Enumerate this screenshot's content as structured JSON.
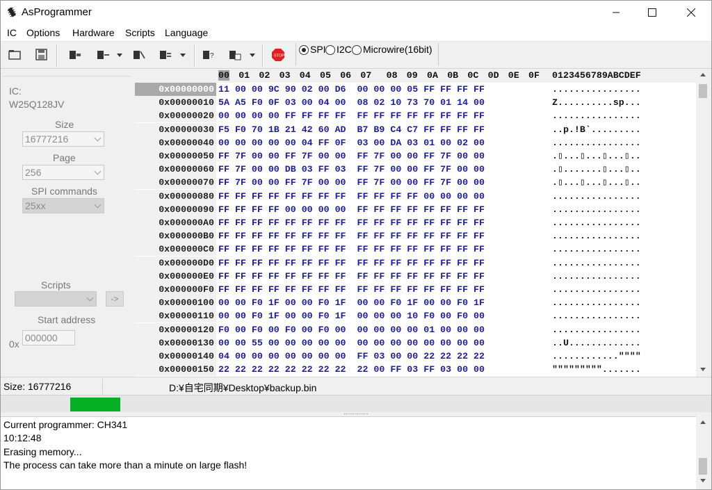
{
  "window": {
    "title": "AsProgrammer"
  },
  "menu": [
    "IC",
    "Options",
    "Hardware",
    "Scripts",
    "Language"
  ],
  "toolbar": {
    "icons": [
      "open-file-icon",
      "save-icon",
      "read-chip-icon",
      "write-chip-icon",
      "erase-chip-icon",
      "verify-chip-icon",
      "read-id-icon",
      "options-icon",
      "stop-icon"
    ],
    "protocols": [
      {
        "label": "SPI",
        "checked": true
      },
      {
        "label": "I2C",
        "checked": false
      },
      {
        "label": "Microwire(16bit)",
        "checked": false
      }
    ]
  },
  "left_panel": {
    "ic_label": "IC:",
    "ic_name": "W25Q128JV",
    "size_label": "Size",
    "size_value": "16777216",
    "page_label": "Page",
    "page_value": "256",
    "spi_commands_label": "SPI commands",
    "spi_commands_value": "25xx",
    "scripts_label": "Scripts",
    "scripts_value": "",
    "run_script_button": "->",
    "start_address_label": "Start address",
    "start_address_prefix": "0x",
    "start_address_value": "000000"
  },
  "hex": {
    "columns": [
      "00",
      "01",
      "02",
      "03",
      "04",
      "05",
      "06",
      "07",
      "08",
      "09",
      "0A",
      "0B",
      "0C",
      "0D",
      "0E",
      "0F"
    ],
    "ascii_header": "0123456789ABCDEF",
    "rows": [
      {
        "addr": "0x00000000",
        "bytes": "11 00 00 9C 90 02 00 D6  00 00 00 05 FF FF FF FF",
        "ascii": "................"
      },
      {
        "addr": "0x00000010",
        "bytes": "5A A5 F0 0F 03 00 04 00  08 02 10 73 70 01 14 00",
        "ascii": "Z..........sp..."
      },
      {
        "addr": "0x00000020",
        "bytes": "00 00 00 00 FF FF FF FF  FF FF FF FF FF FF FF FF",
        "ascii": "................"
      },
      {
        "addr": "0x00000030",
        "bytes": "F5 F0 70 1B 21 42 60 AD  B7 B9 C4 C7 FF FF FF FF",
        "ascii": "..p.!B`........."
      },
      {
        "addr": "0x00000040",
        "bytes": "00 00 00 00 00 04 FF 0F  03 00 DA 03 01 00 02 00",
        "ascii": "................"
      },
      {
        "addr": "0x00000050",
        "bytes": "FF 7F 00 00 FF 7F 00 00  FF 7F 00 00 FF 7F 00 00",
        "ascii": ".▯...▯...▯...▯.."
      },
      {
        "addr": "0x00000060",
        "bytes": "FF 7F 00 00 DB 03 FF 03  FF 7F 00 00 FF 7F 00 00",
        "ascii": ".▯.......▯...▯.."
      },
      {
        "addr": "0x00000070",
        "bytes": "FF 7F 00 00 FF 7F 00 00  FF 7F 00 00 FF 7F 00 00",
        "ascii": ".▯...▯...▯...▯.."
      },
      {
        "addr": "0x00000080",
        "bytes": "FF FF FF FF FF FF FF FF  FF FF FF FF 00 00 00 00",
        "ascii": "................"
      },
      {
        "addr": "0x00000090",
        "bytes": "FF FF FF FF 00 00 00 00  FF FF FF FF FF FF FF FF",
        "ascii": "................"
      },
      {
        "addr": "0x000000A0",
        "bytes": "FF FF FF FF FF FF FF FF  FF FF FF FF FF FF FF FF",
        "ascii": "................"
      },
      {
        "addr": "0x000000B0",
        "bytes": "FF FF FF FF FF FF FF FF  FF FF FF FF FF FF FF FF",
        "ascii": "................"
      },
      {
        "addr": "0x000000C0",
        "bytes": "FF FF FF FF FF FF FF FF  FF FF FF FF FF FF FF FF",
        "ascii": "................"
      },
      {
        "addr": "0x000000D0",
        "bytes": "FF FF FF FF FF FF FF FF  FF FF FF FF FF FF FF FF",
        "ascii": "................"
      },
      {
        "addr": "0x000000E0",
        "bytes": "FF FF FF FF FF FF FF FF  FF FF FF FF FF FF FF FF",
        "ascii": "................"
      },
      {
        "addr": "0x000000F0",
        "bytes": "FF FF FF FF FF FF FF FF  FF FF FF FF FF FF FF FF",
        "ascii": "................"
      },
      {
        "addr": "0x00000100",
        "bytes": "00 00 F0 1F 00 00 F0 1F  00 00 F0 1F 00 00 F0 1F",
        "ascii": "................"
      },
      {
        "addr": "0x00000110",
        "bytes": "00 00 F0 1F 00 00 F0 1F  00 00 00 10 F0 00 F0 00",
        "ascii": "................"
      },
      {
        "addr": "0x00000120",
        "bytes": "F0 00 F0 00 F0 00 F0 00  00 00 00 00 01 00 00 00",
        "ascii": "................"
      },
      {
        "addr": "0x00000130",
        "bytes": "00 00 55 00 00 00 00 00  00 00 00 00 00 00 00 00",
        "ascii": "..U............."
      },
      {
        "addr": "0x00000140",
        "bytes": "04 00 00 00 00 00 00 00  FF 03 00 00 22 22 22 22",
        "ascii": "............\"\"\"\""
      },
      {
        "addr": "0x00000150",
        "bytes": "22 22 22 22 22 22 22 22  22 00 FF 03 FF 03 00 00",
        "ascii": "\"\"\"\"\"\"\"\"\"......."
      }
    ]
  },
  "status": {
    "size_text": "Size: 16777216",
    "file_path": "D:¥自宅同期¥Desktop¥backup.bin",
    "progress_fraction": 0.07,
    "progress_color": "#06b025"
  },
  "log": [
    "Current programmer: CH341",
    "10:12:48",
    "Erasing memory...",
    "The process can take more than a minute on large flash!"
  ]
}
